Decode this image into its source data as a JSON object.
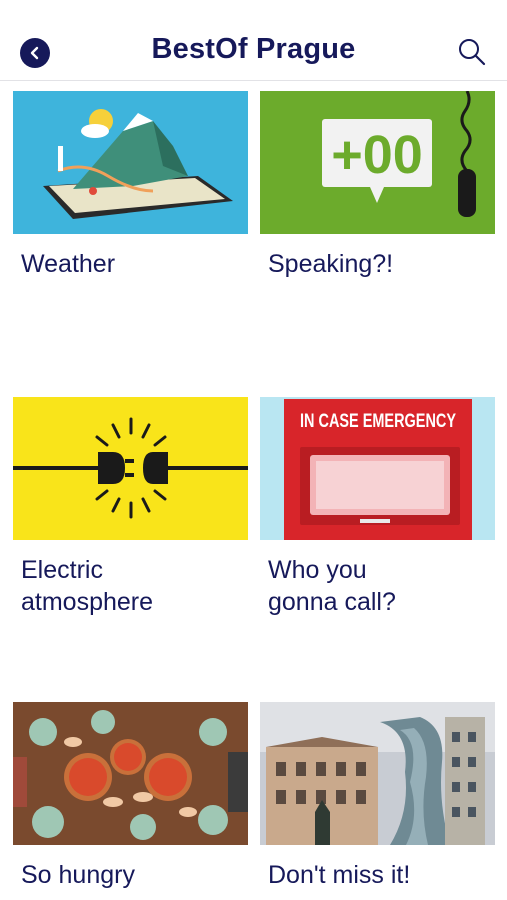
{
  "header": {
    "title": "BestOf Prague",
    "back_icon": "chevron-left-icon",
    "search_icon": "search-icon",
    "accent_color": "#16195a"
  },
  "cards": [
    {
      "label": "Weather",
      "image": "weather-map-tablet"
    },
    {
      "label": "Speaking?!",
      "image": "phone-code-plus00"
    },
    {
      "label": "Electric\natmosphere",
      "image": "power-plug"
    },
    {
      "label": "Who you\ngonna call?",
      "image": "emergency-box"
    },
    {
      "label": "So hungry",
      "image": "pizza-table"
    },
    {
      "label": "Don't miss it!",
      "image": "dancing-house"
    }
  ],
  "images": {
    "speaking_sign": "+00",
    "emergency_sign": "IN CASE EMERGENCY"
  }
}
